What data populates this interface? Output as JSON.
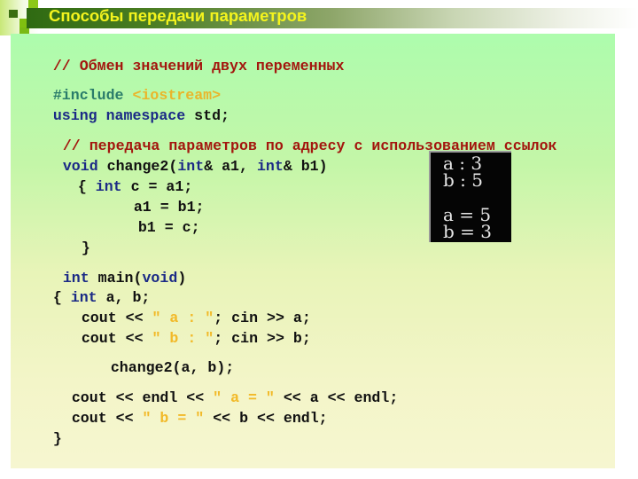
{
  "slide": {
    "title": "Способы передачи параметров",
    "title_color": "#f4f41e"
  },
  "code": {
    "comment_swap": "// Обмен значений двух переменных",
    "include_directive": "#include",
    "include_header": "<iostream>",
    "using_keywords": "using namespace",
    "using_ns": " std;",
    "comment_ref": "// передача параметров по адресу с использованием ссылок",
    "func_void": "void",
    "func_name_open": " change2(",
    "func_int1": "int",
    "func_param1": "& a1, ",
    "func_int2": "int",
    "func_param2": "& b1)",
    "body_open_brace": "{ ",
    "body_int": "int",
    "body_decl": " c = a1;",
    "body_assign1": "a1 = b1;",
    "body_assign2": "b1 = c;",
    "body_close": "}",
    "main_int": "int",
    "main_sig_pre": " main(",
    "main_void": "void",
    "main_sig_post": ")",
    "main_open": "{ ",
    "main_int2": "int",
    "main_decl": " a, b;",
    "cout_a_pre": "cout << ",
    "cout_a_str": "\" a : \"",
    "cout_a_post": "; cin >> a;",
    "cout_b_pre": "cout << ",
    "cout_b_str": "\" b : \"",
    "cout_b_post": "; cin >> b;",
    "call": "change2(a, b);",
    "out_a_pre": "cout << endl << ",
    "out_a_str": "\" a = \"",
    "out_a_post": " << a << endl;",
    "out_b_pre": "cout << ",
    "out_b_str": "\" b = \"",
    "out_b_post": " << b << endl;",
    "main_close": "}"
  },
  "console_output": {
    "lines": [
      "a : 3",
      "b : 5",
      "a = 5",
      "b = 3"
    ]
  }
}
